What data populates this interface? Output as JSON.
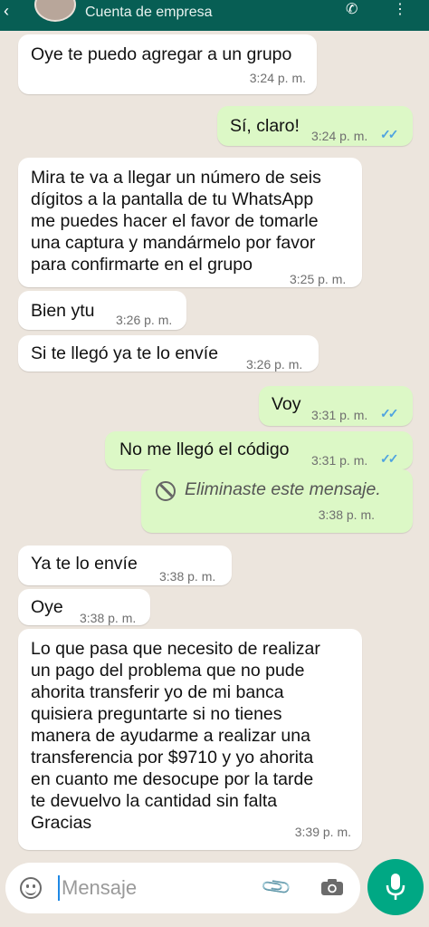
{
  "header": {
    "subtitle": "Cuenta de empresa"
  },
  "messages": [
    {
      "dir": "in",
      "text": "Oye te puedo agregar a un grupo",
      "time": "3:24 p. m."
    },
    {
      "dir": "out",
      "text": "Sí, claro!",
      "time": "3:24 p. m.",
      "status": "read"
    },
    {
      "dir": "in",
      "text": "Mira te va a llegar un número de seis\ndígitos a la pantalla de tu WhatsApp\nme puedes hacer el favor de tomarle\nuna captura y mandármelo por favor\npara confirmarte en el grupo",
      "time": "3:25 p. m."
    },
    {
      "dir": "in",
      "text": "Bien ytu",
      "time": "3:26 p. m."
    },
    {
      "dir": "in",
      "text": "Si te llegó ya te lo envíe",
      "time": "3:26 p. m."
    },
    {
      "dir": "out",
      "text": "Voy",
      "time": "3:31 p. m.",
      "status": "read"
    },
    {
      "dir": "out",
      "text": "No me llegó el código",
      "time": "3:31 p. m.",
      "status": "read"
    },
    {
      "dir": "out",
      "text": "Eliminaste este mensaje.",
      "time": "3:38 p. m.",
      "deleted": true
    },
    {
      "dir": "in",
      "text": "Ya te lo envíe",
      "time": "3:38 p. m."
    },
    {
      "dir": "in",
      "text": "Oye",
      "time": "3:38 p. m."
    },
    {
      "dir": "in",
      "text": "Lo que pasa que necesito de realizar\nun pago del problema que no pude\nahorita transferir yo de mi banca\nquisiera preguntarte si no tienes\nmanera de ayudarme a realizar una\ntransferencia por $9710 y yo ahorita\nen cuanto me desocupe por la tarde\nte devuelvo la cantidad sin falta\nGracias",
      "time": "3:39 p. m."
    }
  ],
  "composer": {
    "placeholder": "Mensaje"
  },
  "colors": {
    "header": "#075e54",
    "outgoing": "#dcf8c6",
    "incoming": "#ffffff",
    "background": "#ece5dd",
    "read_ticks": "#4fa3e0",
    "mic_button": "#00a884"
  },
  "icons": {
    "back": "arrow-left-icon",
    "call": "phone-icon",
    "menu": "more-vertical-icon",
    "deleted": "block-icon",
    "emoji": "emoji-icon",
    "attach": "paperclip-icon",
    "camera": "camera-icon",
    "mic": "microphone-icon",
    "read": "double-check-icon"
  }
}
